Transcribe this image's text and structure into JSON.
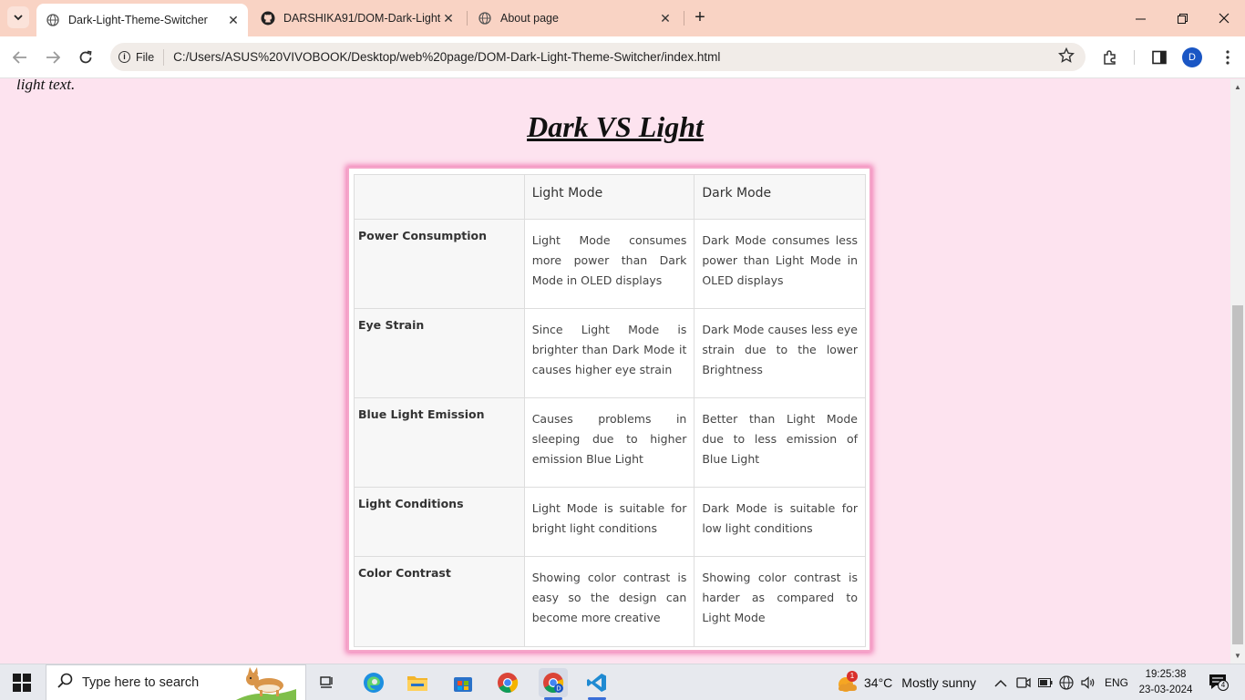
{
  "browser": {
    "tabs": [
      {
        "title": "Dark-Light-Theme-Switcher",
        "icon": "globe-icon",
        "active": true
      },
      {
        "title": "DARSHIKA91/DOM-Dark-Light-",
        "icon": "github-icon",
        "active": false
      },
      {
        "title": "About page",
        "icon": "globe-icon",
        "active": false
      }
    ],
    "close_glyph": "✕",
    "new_tab_glyph": "+",
    "address": {
      "scheme_chip": "File",
      "url": "C:/Users/ASUS%20VIVOBOOK/Desktop/web%20page/DOM-Dark-Light-Theme-Switcher/index.html"
    },
    "profile_initial": "D"
  },
  "page": {
    "lead_text": "light text.",
    "heading": "Dark VS Light",
    "table": {
      "headers": [
        "",
        "Light Mode",
        "Dark Mode"
      ],
      "rows": [
        {
          "label": "Power Consumption",
          "light": "Light Mode consumes more power than Dark Mode in OLED displays",
          "dark": "Dark Mode consumes less power than Light Mode in OLED displays"
        },
        {
          "label": "Eye Strain",
          "light": "Since Light Mode is brighter than Dark Mode it causes higher eye strain",
          "dark": "Dark Mode causes less eye strain due to the lower Brightness"
        },
        {
          "label": "Blue Light Emission",
          "light": "Causes problems in sleeping due to higher emission Blue Light",
          "dark": "Better than Light Mode due to less emission of Blue Light"
        },
        {
          "label": "Light Conditions",
          "light": "Light Mode is suitable for bright light conditions",
          "dark": "Dark Mode is suitable for low light conditions"
        },
        {
          "label": "Color Contrast",
          "light": "Showing color contrast is easy so the design can become more creative",
          "dark": "Showing color contrast is harder as compared to Light Mode"
        }
      ]
    }
  },
  "taskbar": {
    "search_placeholder": "Type here to search",
    "weather": {
      "temp": "34°C",
      "condition": "Mostly sunny",
      "badge": "1"
    },
    "language": "ENG",
    "time": "19:25:38",
    "date": "23-03-2024",
    "notification_count": "4"
  },
  "colors": {
    "page_bg": "#fde3ef",
    "tabbar_bg": "#f9d3c4",
    "table_glow": "#f07ab3"
  }
}
